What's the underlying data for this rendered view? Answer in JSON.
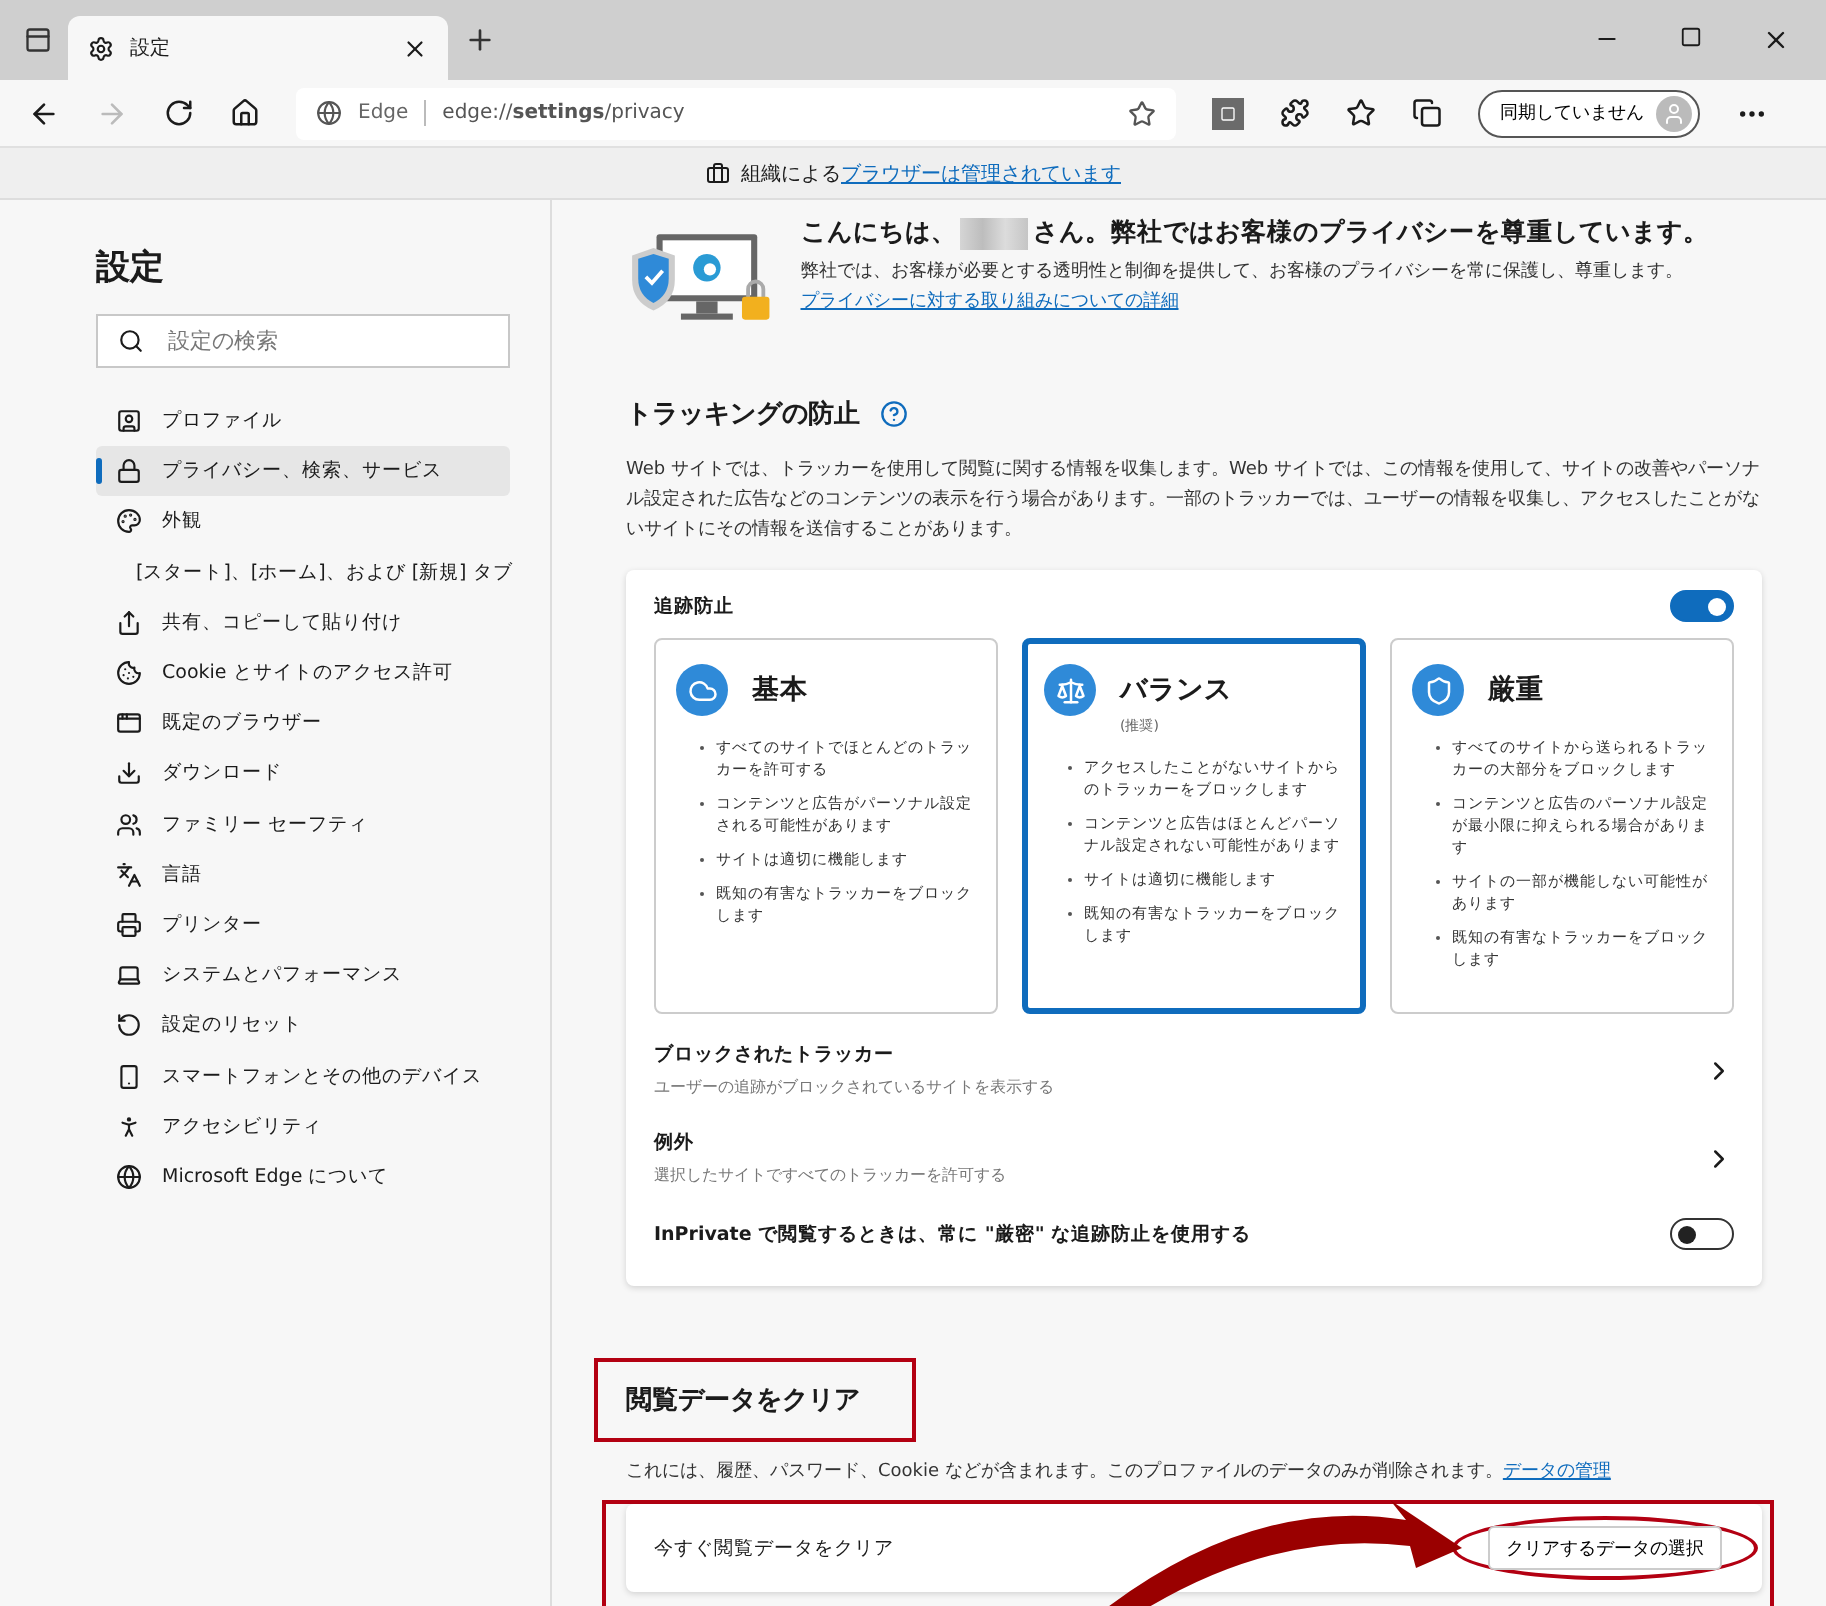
{
  "window": {
    "tab_title": "設定",
    "address_site": "Edge",
    "address_url": "edge://**settings**/privacy",
    "sync_button": "同期していません"
  },
  "info_bar": {
    "text": "組織による",
    "link": "ブラウザーは管理されています"
  },
  "sidebar": {
    "title": "設定",
    "search": {
      "placeholder": "設定の検索"
    },
    "items": [
      {
        "label": "プロファイル",
        "selected": false
      },
      {
        "label": "プライバシー、検索、サービス",
        "selected": true
      },
      {
        "label": "外観",
        "selected": false
      },
      {
        "label": "[スタート]、[ホーム]、および [新規] タブ",
        "selected": false
      },
      {
        "label": "共有、コピーして貼り付け",
        "selected": false
      },
      {
        "label": "Cookie とサイトのアクセス許可",
        "selected": false
      },
      {
        "label": "既定のブラウザー",
        "selected": false
      },
      {
        "label": "ダウンロード",
        "selected": false
      },
      {
        "label": "ファミリー セーフティ",
        "selected": false
      },
      {
        "label": "言語",
        "selected": false
      },
      {
        "label": "プリンター",
        "selected": false
      },
      {
        "label": "システムとパフォーマンス",
        "selected": false
      },
      {
        "label": "設定のリセット",
        "selected": false
      },
      {
        "label": "スマートフォンとその他のデバイス",
        "selected": false
      },
      {
        "label": "アクセシビリティ",
        "selected": false
      },
      {
        "label": "Microsoft Edge について",
        "selected": false
      }
    ]
  },
  "hero": {
    "greeting_before": "こんにちは、",
    "greeting_after": "さん。弊社ではお客様のプライバシーを尊重しています。",
    "description": "弊社では、お客様が必要とする透明性と制御を提供して、お客様のプライバシーを常に保護し、尊重します。",
    "link": "プライバシーに対する取り組みについての詳細"
  },
  "tracking": {
    "heading": "トラッキングの防止",
    "description": "Web サイトでは、トラッカーを使用して閲覧に関する情報を収集します。Web サイトでは、この情報を使用して、サイトの改善やパーソナル設定された広告などのコンテンツの表示を行う場合があります。一部のトラッカーでは、ユーザーの情報を収集し、アクセスしたことがないサイトにその情報を送信することがあります。",
    "toggle_label": "追跡防止",
    "on": true,
    "levels": [
      {
        "name": "基本",
        "selected": false,
        "bullets": [
          "すべてのサイトでほとんどのトラッカーを許可する",
          "コンテンツと広告がパーソナル設定される可能性があります",
          "サイトは適切に機能します",
          "既知の有害なトラッカーをブロックします"
        ]
      },
      {
        "name": "バランス",
        "note": "(推奨)",
        "selected": true,
        "bullets": [
          "アクセスしたことがないサイトからのトラッカーをブロックします",
          "コンテンツと広告はほとんどパーソナル設定されない可能性があります",
          "サイトは適切に機能します",
          "既知の有害なトラッカーをブロックします"
        ]
      },
      {
        "name": "厳重",
        "selected": false,
        "bullets": [
          "すべてのサイトから送られるトラッカーの大部分をブロックします",
          "コンテンツと広告のパーソナル設定が最小限に抑えられる場合があります",
          "サイトの一部が機能しない可能性があります",
          "既知の有害なトラッカーをブロックします"
        ]
      }
    ],
    "rows": [
      {
        "kind": "link",
        "title": "ブロックされたトラッカー",
        "subtitle": "ユーザーの追跡がブロックされているサイトを表示する"
      },
      {
        "kind": "link",
        "title": "例外",
        "subtitle": "選択したサイトですべてのトラッカーを許可する"
      },
      {
        "kind": "toggle",
        "title": "InPrivate で閲覧するときは、常に \"厳密\" な追跡防止を使用する",
        "on": false
      }
    ]
  },
  "clear": {
    "heading": "閲覧データをクリア",
    "description": "これには、履歴、パスワード、Cookie などが含まれます。このプロファイルのデータのみが削除されます。",
    "link": "データの管理",
    "row_label": "今すぐ閲覧データをクリア",
    "button": "クリアするデータの選択"
  }
}
